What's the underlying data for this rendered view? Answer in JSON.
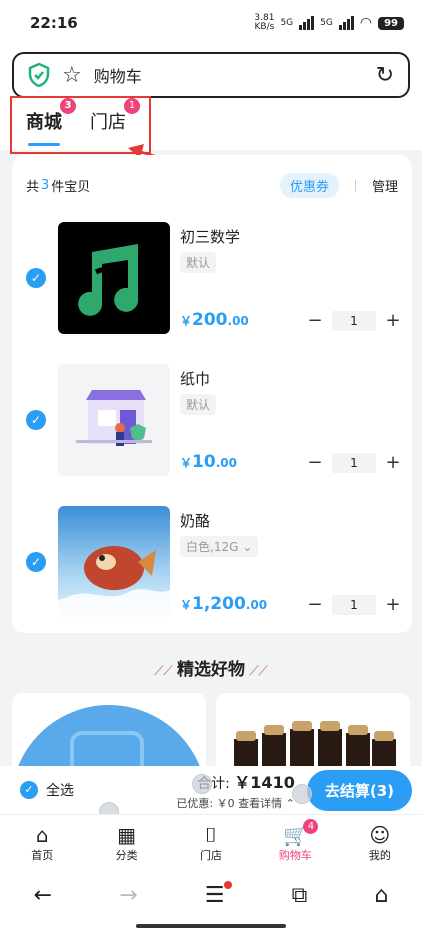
{
  "status": {
    "time": "22:16",
    "net_speed": "3.81",
    "net_unit": "KB/s",
    "signal1": "5G",
    "signal2": "5G",
    "battery": "99"
  },
  "search": {
    "title": "购物车"
  },
  "tabs": [
    {
      "label": "商城",
      "badge": "3"
    },
    {
      "label": "门店",
      "badge": "1"
    }
  ],
  "cart": {
    "summary_prefix": "共",
    "summary_count": "3",
    "summary_suffix": "件宝贝",
    "coupon": "优惠券",
    "manage": "管理",
    "items": [
      {
        "name": "初三数学",
        "spec": "默认",
        "price_int": "200",
        "price_dec": ".00",
        "qty": "1"
      },
      {
        "name": "纸巾",
        "spec": "默认",
        "price_int": "10",
        "price_dec": ".00",
        "qty": "1"
      },
      {
        "name": "奶酪",
        "spec": "白色,12G",
        "price_int": "1,200",
        "price_dec": ".00",
        "qty": "1"
      }
    ],
    "currency": "￥"
  },
  "recommend": {
    "title": "精选好物"
  },
  "checkout": {
    "select_all": "全选",
    "total_label": "合计:",
    "total_value": "￥1410",
    "discount": "已优惠: ￥0 查看详情",
    "button": "去结算(3)"
  },
  "tabbar": [
    {
      "label": "首页",
      "icon": "home-icon"
    },
    {
      "label": "分类",
      "icon": "category-icon"
    },
    {
      "label": "门店",
      "icon": "store-icon"
    },
    {
      "label": "购物车",
      "icon": "cart-icon",
      "badge": "4"
    },
    {
      "label": "我的",
      "icon": "profile-icon"
    }
  ],
  "colors": {
    "accent": "#2a9df4",
    "badge": "#f0437b",
    "highlight": "#e53935"
  }
}
